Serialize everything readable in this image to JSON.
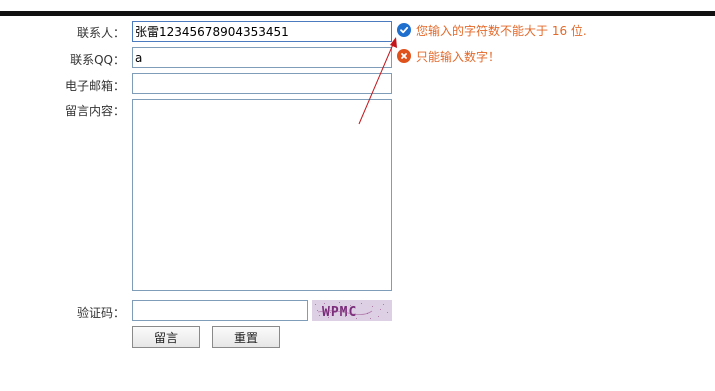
{
  "form": {
    "contact": {
      "label": "联系人：",
      "value": "张雷12345678904353451"
    },
    "qq": {
      "label": "联系QQ：",
      "value": "a"
    },
    "email": {
      "label": "电子邮箱：",
      "value": ""
    },
    "message": {
      "label": "留言内容：",
      "value": ""
    },
    "captcha": {
      "label": "验证码：",
      "value": "",
      "image_text": "WPMC"
    }
  },
  "validation": {
    "contact": {
      "status": "ok",
      "text": "您输入的字符数不能大于 16 位."
    },
    "qq": {
      "status": "error",
      "text": "只能输入数字！"
    }
  },
  "buttons": {
    "submit_label": "留言",
    "reset_label": "重置"
  },
  "colors": {
    "message_text": "#e3692a",
    "ok_icon": "#1f6fce",
    "error_icon": "#e0521c",
    "arrow": "#c3161c",
    "field_border": "#7f9db9",
    "captcha_bg": "#ddd0e4"
  },
  "icons": {
    "ok": "check-circle-icon",
    "error": "x-circle-icon"
  }
}
